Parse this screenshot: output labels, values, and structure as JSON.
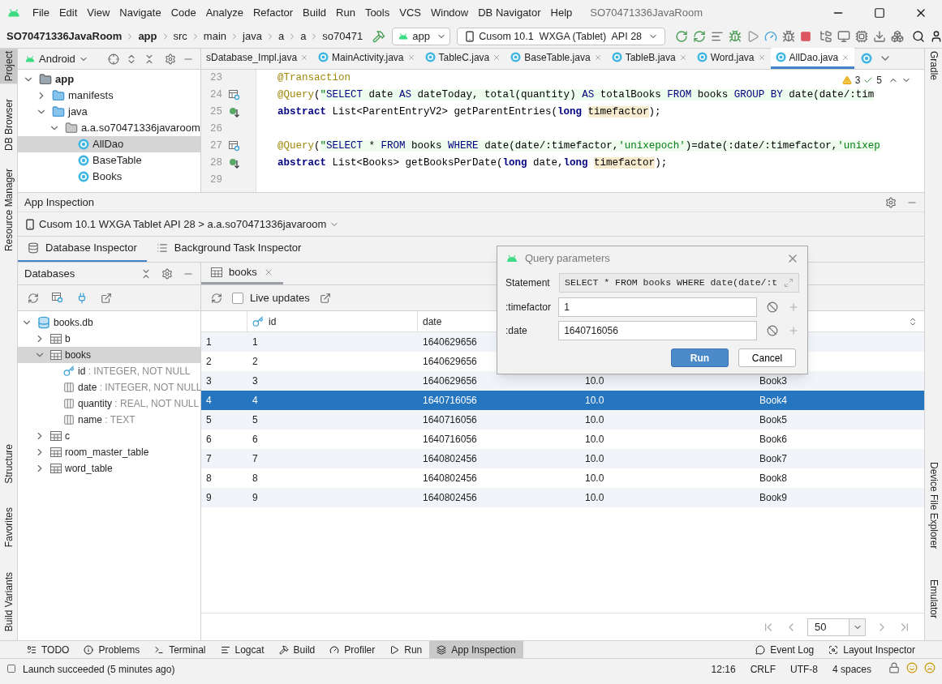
{
  "menu_bar": {
    "items": [
      "File",
      "Edit",
      "View",
      "Navigate",
      "Code",
      "Analyze",
      "Refactor",
      "Build",
      "Run",
      "Tools",
      "VCS",
      "Window",
      "DB Navigator",
      "Help"
    ],
    "title": "SO70471336JavaRoom"
  },
  "breadcrumbs": [
    {
      "label": "SO70471336JavaRoom",
      "bold": true
    },
    {
      "label": "app",
      "bold": true
    },
    {
      "label": "src",
      "bold": false
    },
    {
      "label": "main",
      "bold": false
    },
    {
      "label": "java",
      "bold": false
    },
    {
      "label": "a",
      "bold": false
    },
    {
      "label": "a",
      "bold": false
    },
    {
      "label": "so70471",
      "bold": false
    }
  ],
  "run_config": "app",
  "device": "Cusom 10.1  WXGA (Tablet)  API 28",
  "left_stripe": {
    "top": [
      {
        "label": "Project",
        "selected": true
      },
      {
        "label": "DB Browser",
        "selected": false
      },
      {
        "label": "Resource Manager",
        "selected": false
      }
    ],
    "bottom": [
      {
        "label": "Structure",
        "selected": false
      },
      {
        "label": "Favorites",
        "selected": false
      },
      {
        "label": "Build Variants",
        "selected": false
      }
    ]
  },
  "right_stripe": {
    "top": [
      "Gradle"
    ],
    "bottom": [
      "Device File Explorer",
      "Emulator"
    ]
  },
  "project_panel": {
    "view": "Android",
    "tree": [
      {
        "label": "app",
        "kind": "module",
        "expanded": true,
        "selected": false,
        "children": [
          {
            "label": "manifests",
            "kind": "folder",
            "expanded": false,
            "selected": false
          },
          {
            "label": "java",
            "kind": "folder",
            "expanded": true,
            "selected": false,
            "children": [
              {
                "label": "a.a.so70471336javaroom",
                "kind": "package",
                "expanded": true,
                "selected": false,
                "children": [
                  {
                    "label": "AllDao",
                    "kind": "class",
                    "selected": true
                  },
                  {
                    "label": "BaseTable",
                    "kind": "class",
                    "selected": false
                  },
                  {
                    "label": "Books",
                    "kind": "class",
                    "selected": false
                  }
                ]
              }
            ]
          }
        ]
      }
    ]
  },
  "editor_tabs": [
    {
      "label": "sDatabase_Impl.java",
      "kind": "partial",
      "selected": false
    },
    {
      "label": "MainActivity.java",
      "kind": "class",
      "selected": false
    },
    {
      "label": "TableC.java",
      "kind": "class",
      "selected": false
    },
    {
      "label": "BaseTable.java",
      "kind": "class",
      "selected": false
    },
    {
      "label": "TableB.java",
      "kind": "class",
      "selected": false
    },
    {
      "label": "Word.java",
      "kind": "class",
      "selected": false
    },
    {
      "label": "AllDao.java",
      "kind": "class",
      "selected": true
    }
  ],
  "inspections": {
    "warnings": "3",
    "passed": "5"
  },
  "code_lines": [
    {
      "number": "23",
      "segments": [
        {
          "kind": "annotation",
          "text": "@Transaction"
        }
      ]
    },
    {
      "number": "24",
      "kind": "query",
      "segments": [
        {
          "kind": "annotation",
          "text": "@Query"
        },
        {
          "kind": "plain",
          "text": "("
        },
        {
          "kind": "string",
          "text": "\""
        },
        {
          "kind": "sql-keyword",
          "text": "SELECT"
        },
        {
          "kind": "sql",
          "text": " date "
        },
        {
          "kind": "sql-keyword",
          "text": "AS"
        },
        {
          "kind": "sql",
          "text": " dateToday, total(quantity) "
        },
        {
          "kind": "sql-keyword",
          "text": "AS"
        },
        {
          "kind": "sql",
          "text": " totalBooks "
        },
        {
          "kind": "sql-keyword",
          "text": "FROM"
        },
        {
          "kind": "sql",
          "text": " books "
        },
        {
          "kind": "sql-keyword",
          "text": "GROUP BY"
        },
        {
          "kind": "sql",
          "text": " date(date/:tim"
        }
      ]
    },
    {
      "number": "25",
      "kind": "implemented",
      "segments": [
        {
          "kind": "keyword",
          "text": "abstract"
        },
        {
          "kind": "plain",
          "text": " List<ParentEntryV2> getParentEntries("
        },
        {
          "kind": "keyword",
          "text": "long "
        },
        {
          "kind": "param",
          "text": "timefactor"
        },
        {
          "kind": "plain",
          "text": ");"
        }
      ]
    },
    {
      "number": "26"
    },
    {
      "number": "27",
      "kind": "query",
      "segments": [
        {
          "kind": "annotation",
          "text": "@Query"
        },
        {
          "kind": "plain",
          "text": "("
        },
        {
          "kind": "string",
          "text": "\""
        },
        {
          "kind": "sql-keyword",
          "text": "SELECT"
        },
        {
          "kind": "sql",
          "text": " * "
        },
        {
          "kind": "sql-keyword",
          "text": "FROM"
        },
        {
          "kind": "sql",
          "text": " books "
        },
        {
          "kind": "sql-keyword",
          "text": "WHERE"
        },
        {
          "kind": "sql",
          "text": " date(date/:timefactor,"
        },
        {
          "kind": "sql-string",
          "text": "'unixepoch'"
        },
        {
          "kind": "sql",
          "text": ")=date(:date/:timefactor,"
        },
        {
          "kind": "sql-string",
          "text": "'unixep"
        }
      ]
    },
    {
      "number": "28",
      "kind": "implemented",
      "segments": [
        {
          "kind": "keyword",
          "text": "abstract"
        },
        {
          "kind": "plain",
          "text": " List<Books> getBooksPerDate("
        },
        {
          "kind": "keyword",
          "text": "long"
        },
        {
          "kind": "plain",
          "text": " date,"
        },
        {
          "kind": "keyword",
          "text": "long "
        },
        {
          "kind": "param",
          "text": "timefactor"
        },
        {
          "kind": "plain",
          "text": ");"
        }
      ]
    },
    {
      "number": "29"
    }
  ],
  "app_inspection": {
    "title": "App Inspection",
    "process": "Cusom 10.1 WXGA Tablet API 28 > a.a.so70471336javaroom",
    "tabs": [
      {
        "label": "Database Inspector",
        "selected": true
      },
      {
        "label": "Background Task Inspector",
        "selected": false
      }
    ],
    "databases": {
      "title": "Databases",
      "tree": [
        {
          "label": "books.db",
          "kind": "database",
          "expanded": true,
          "selected": false,
          "children": [
            {
              "label": "b",
              "kind": "table",
              "expanded": false,
              "selected": false
            },
            {
              "label": "books",
              "kind": "table",
              "expanded": true,
              "selected": true,
              "children": [
                {
                  "label": "id",
                  "kind": "primary-key",
                  "type": ": INTEGER, NOT NULL",
                  "selected": false
                },
                {
                  "label": "date",
                  "kind": "column",
                  "type": ": INTEGER, NOT NULL",
                  "selected": false
                },
                {
                  "label": "quantity",
                  "kind": "column",
                  "type": ": REAL, NOT NULL",
                  "selected": false
                },
                {
                  "label": "name",
                  "kind": "column",
                  "type": ": TEXT",
                  "selected": false
                }
              ]
            },
            {
              "label": "c",
              "kind": "table",
              "expanded": false,
              "selected": false
            },
            {
              "label": "room_master_table",
              "kind": "table",
              "expanded": false,
              "selected": false
            },
            {
              "label": "word_table",
              "kind": "table",
              "expanded": false,
              "selected": false
            }
          ]
        }
      ]
    },
    "table_tab": "books",
    "live_updates": {
      "label": "Live updates",
      "checked": false
    },
    "table": {
      "columns": [
        "",
        "id",
        "date"
      ],
      "rows": [
        {
          "selected": false,
          "cells": [
            "1",
            "1",
            "1640629656"
          ]
        },
        {
          "selected": false,
          "cells": [
            "2",
            "2",
            "1640629656"
          ]
        },
        {
          "selected": false,
          "cells": [
            "3",
            "3",
            "1640629656",
            "10.0",
            "Book3"
          ]
        },
        {
          "selected": true,
          "cells": [
            "4",
            "4",
            "1640716056",
            "10.0",
            "Book4"
          ]
        },
        {
          "selected": false,
          "cells": [
            "5",
            "5",
            "1640716056",
            "10.0",
            "Book5"
          ]
        },
        {
          "selected": false,
          "cells": [
            "6",
            "6",
            "1640716056",
            "10.0",
            "Book6"
          ]
        },
        {
          "selected": false,
          "cells": [
            "7",
            "7",
            "1640802456",
            "10.0",
            "Book7"
          ]
        },
        {
          "selected": false,
          "cells": [
            "8",
            "8",
            "1640802456",
            "10.0",
            "Book8"
          ]
        },
        {
          "selected": false,
          "cells": [
            "9",
            "9",
            "1640802456",
            "10.0",
            "Book9"
          ]
        }
      ]
    },
    "page_size": "50"
  },
  "dialog": {
    "title": "Query parameters",
    "statement_label": "Statement",
    "statement": "SELECT * FROM books WHERE date(date/:t",
    "params": [
      {
        "name": ":timefactor",
        "value": "1"
      },
      {
        "name": ":date",
        "value": "1640716056"
      }
    ],
    "buttons": [
      {
        "label": "Run",
        "kind": "primary"
      },
      {
        "label": "Cancel",
        "kind": "secondary"
      }
    ]
  },
  "tool_windows": {
    "left": [
      {
        "label": "TODO",
        "selected": false
      },
      {
        "label": "Problems",
        "selected": false
      },
      {
        "label": "Terminal",
        "selected": false
      },
      {
        "label": "Logcat",
        "selected": false
      },
      {
        "label": "Build",
        "selected": false
      },
      {
        "label": "Profiler",
        "selected": false
      },
      {
        "label": "Run",
        "selected": false
      },
      {
        "label": "App Inspection",
        "selected": true
      }
    ],
    "right": [
      "Event Log",
      "Layout Inspector"
    ]
  },
  "status_bar": {
    "message": "Launch succeeded (5 minutes ago)",
    "items": [
      "12:16",
      "CRLF",
      "UTF-8",
      "4 spaces"
    ]
  }
}
